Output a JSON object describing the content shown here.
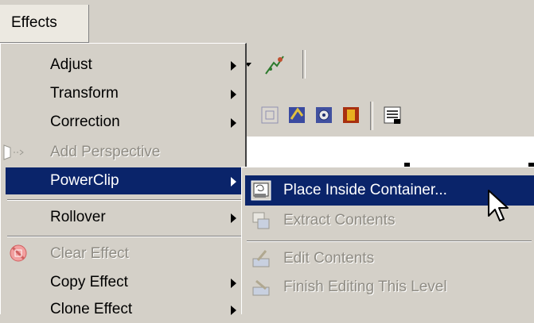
{
  "menubar": {
    "effects_label": "Effects"
  },
  "menu": {
    "items": [
      {
        "label": "Adjust",
        "has_submenu": true,
        "enabled": true
      },
      {
        "label": "Transform",
        "has_submenu": true,
        "enabled": true
      },
      {
        "label": "Correction",
        "has_submenu": true,
        "enabled": true
      },
      {
        "label": "Add Perspective",
        "has_submenu": false,
        "enabled": false
      },
      {
        "label": "PowerClip",
        "has_submenu": true,
        "enabled": true,
        "highlighted": true
      },
      {
        "label": "Rollover",
        "has_submenu": true,
        "enabled": true
      },
      {
        "label": "Clear Effect",
        "has_submenu": false,
        "enabled": false
      },
      {
        "label": "Copy Effect",
        "has_submenu": true,
        "enabled": true
      },
      {
        "label": "Clone Effect",
        "has_submenu": true,
        "enabled": true
      }
    ]
  },
  "submenu": {
    "items": [
      {
        "label": "Place Inside Container...",
        "icon": "place-inside-icon",
        "enabled": true,
        "highlighted": true
      },
      {
        "label": "Extract Contents",
        "icon": "extract-contents-icon",
        "enabled": false
      },
      {
        "label": "Edit Contents",
        "icon": "edit-contents-icon",
        "enabled": false
      },
      {
        "label": "Finish Editing This Level",
        "icon": "finish-editing-icon",
        "enabled": false
      }
    ]
  },
  "colors": {
    "highlight": "#0a246a",
    "menu_bg": "#d4d0c8",
    "disabled_text": "#8f8c84"
  }
}
